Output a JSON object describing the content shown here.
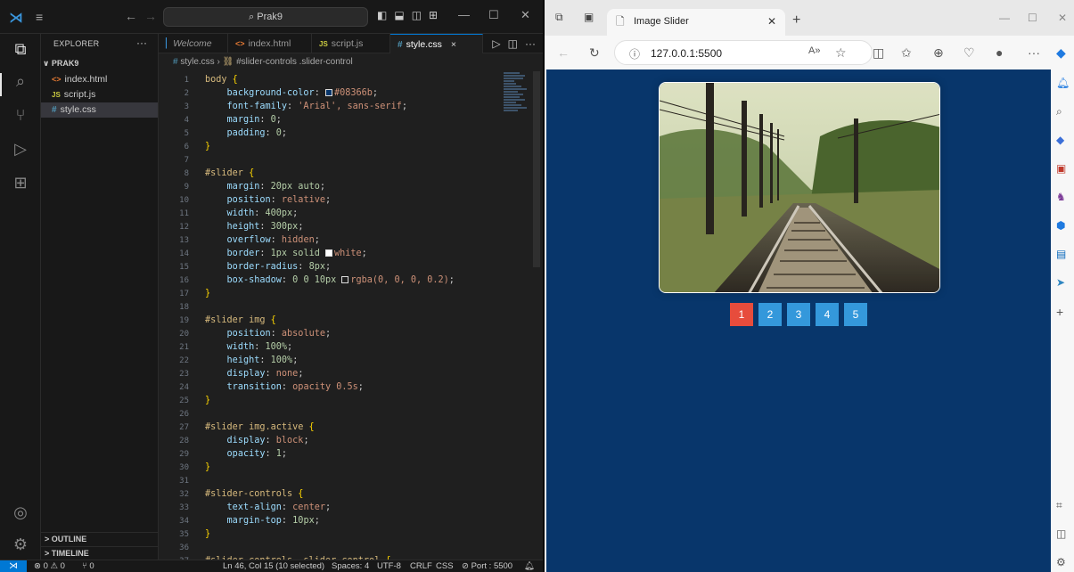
{
  "vscode": {
    "search_text": "Prak9",
    "sidebar": {
      "header": "EXPLORER",
      "more": "···",
      "folder": "PRAK9",
      "files": [
        {
          "icon": "<>",
          "name": "index.html"
        },
        {
          "icon": "JS",
          "name": "script.js"
        },
        {
          "icon": "#",
          "name": "style.css"
        }
      ],
      "outline": "OUTLINE",
      "timeline": "TIMELINE"
    },
    "tabs": [
      {
        "label": "Welcome"
      },
      {
        "icon": "<>",
        "label": "index.html"
      },
      {
        "icon": "JS",
        "label": "script.js"
      },
      {
        "icon": "#",
        "label": "style.css",
        "close": "×"
      }
    ],
    "breadcrumb": {
      "file": "style.css",
      "symbol": "#slider-controls .slider-control"
    },
    "code_lines": [
      {
        "n": "1",
        "sel": "body",
        "brace": " {"
      },
      {
        "n": "2",
        "prop": "background-color",
        "swatch": "#08366b",
        "val": "#08366b"
      },
      {
        "n": "3",
        "prop": "font-family",
        "val": "'Arial', sans-serif"
      },
      {
        "n": "4",
        "prop": "margin",
        "num": "0"
      },
      {
        "n": "5",
        "prop": "padding",
        "num": "0"
      },
      {
        "n": "6",
        "close": "}"
      },
      {
        "n": "7"
      },
      {
        "n": "8",
        "sel": "#slider",
        "brace": " {"
      },
      {
        "n": "9",
        "prop": "margin",
        "num": "20px auto"
      },
      {
        "n": "10",
        "prop": "position",
        "val": "relative"
      },
      {
        "n": "11",
        "prop": "width",
        "num": "400px"
      },
      {
        "n": "12",
        "prop": "height",
        "num": "300px"
      },
      {
        "n": "13",
        "prop": "overflow",
        "val": "hidden"
      },
      {
        "n": "14",
        "prop": "border",
        "num": "1px solid",
        "swatch": "#ffffff",
        "val": "white"
      },
      {
        "n": "15",
        "prop": "border-radius",
        "num": "8px"
      },
      {
        "n": "16",
        "prop": "box-shadow",
        "num": "0 0 10px",
        "swatch": "transparent",
        "val": "rgba(0, 0, 0, 0.2)"
      },
      {
        "n": "17",
        "close": "}"
      },
      {
        "n": "18"
      },
      {
        "n": "19",
        "sel": "#slider img",
        "brace": " {"
      },
      {
        "n": "20",
        "prop": "position",
        "val": "absolute"
      },
      {
        "n": "21",
        "prop": "width",
        "num": "100%"
      },
      {
        "n": "22",
        "prop": "height",
        "num": "100%"
      },
      {
        "n": "23",
        "prop": "display",
        "val": "none"
      },
      {
        "n": "24",
        "prop": "transition",
        "val": "opacity 0.5s"
      },
      {
        "n": "25",
        "close": "}"
      },
      {
        "n": "26"
      },
      {
        "n": "27",
        "sel": "#slider img.active",
        "brace": " {"
      },
      {
        "n": "28",
        "prop": "display",
        "val": "block"
      },
      {
        "n": "29",
        "prop": "opacity",
        "num": "1"
      },
      {
        "n": "30",
        "close": "}"
      },
      {
        "n": "31"
      },
      {
        "n": "32",
        "sel": "#slider-controls",
        "brace": " {"
      },
      {
        "n": "33",
        "prop": "text-align",
        "val": "center"
      },
      {
        "n": "34",
        "prop": "margin-top",
        "num": "10px"
      },
      {
        "n": "35",
        "close": "}"
      },
      {
        "n": "36"
      },
      {
        "n": "37",
        "sel": "#slider-controls .slider-control",
        "brace": " {"
      }
    ],
    "status": {
      "problems": "⊗ 0 ⚠ 0",
      "ports": "⑂ 0",
      "position": "Ln 46, Col 15 (10 selected)",
      "spaces": "Spaces: 4",
      "encoding": "UTF-8",
      "eol": "CRLF",
      "language": "CSS",
      "port": "⊘ Port : 5500"
    }
  },
  "edge": {
    "tab_title": "Image Slider",
    "url": "127.0.0.1:5500",
    "slider_buttons": [
      "1",
      "2",
      "3",
      "4",
      "5"
    ],
    "active_button_index": 0,
    "page_background": "#08366b"
  }
}
